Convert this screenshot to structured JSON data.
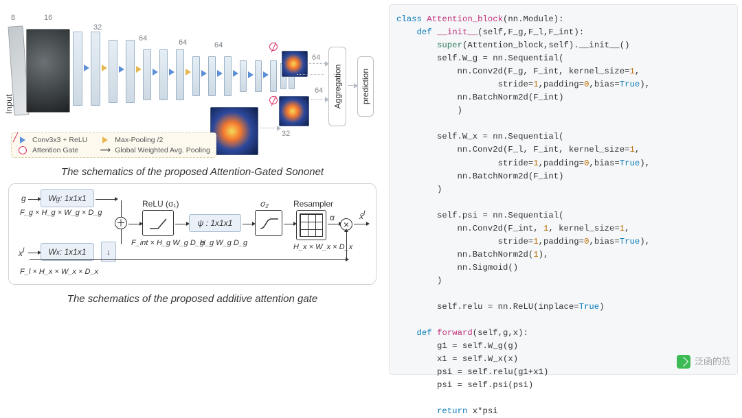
{
  "top": {
    "input_label": "Input",
    "channels": [
      "8",
      "16",
      "32",
      "64",
      "64",
      "64"
    ],
    "side_numbers": {
      "n64a": "64",
      "n64b": "64",
      "n32": "32"
    },
    "agg": "Aggregation",
    "pred": "prediction",
    "legend": {
      "conv": "Conv3x3 + ReLU",
      "maxpool": "Max-Pooling /2",
      "gate": "Attention Gate",
      "gwap": "Global Weighted Avg. Pooling"
    },
    "caption": "The schematics of the proposed Attention-Gated Sononet"
  },
  "gate": {
    "g": "g",
    "xl": "x",
    "xl_sup": "l",
    "Wg": "W",
    "Wg_sub": "g",
    "conv1": ": 1x1x1",
    "Wx": "W",
    "Wx_sub": "x",
    "Fg": "F_g × H_g × W_g × D_g",
    "Fl": "F_l × H_x × W_x × D_x",
    "Fint": "F_int × H_g W_g  D_g",
    "relu": "ReLU (σ₁)",
    "psi": "ψ : 1x1x1",
    "HgWgDg": "H_g W_g  D_g",
    "sigma2": "σ₂",
    "resampler": "Resampler",
    "HxWxDx": "H_x × W_x × D_x",
    "alpha": "α",
    "xhat": "x̂",
    "xhat_sup": "l",
    "caption": "The schematics of the proposed additive attention gate"
  },
  "code": {
    "l1": "class Attention_block(nn.Module):",
    "l2": "    def __init__(self,F_g,F_l,F_int):",
    "l3": "        super(Attention_block,self).__init__()",
    "l4": "        self.W_g = nn.Sequential(",
    "l5": "            nn.Conv2d(F_g, F_int, kernel_size=1,",
    "l6": "                    stride=1,padding=0,bias=True),",
    "l7": "            nn.BatchNorm2d(F_int)",
    "l8": "            )",
    "l9": "",
    "l10": "        self.W_x = nn.Sequential(",
    "l11": "            nn.Conv2d(F_l, F_int, kernel_size=1,",
    "l12": "                    stride=1,padding=0,bias=True),",
    "l13": "            nn.BatchNorm2d(F_int)",
    "l14": "        )",
    "l15": "",
    "l16": "        self.psi = nn.Sequential(",
    "l17": "            nn.Conv2d(F_int, 1, kernel_size=1,",
    "l18": "                    stride=1,padding=0,bias=True),",
    "l19": "            nn.BatchNorm2d(1),",
    "l20": "            nn.Sigmoid()",
    "l21": "        )",
    "l22": "",
    "l23": "        self.relu = nn.ReLU(inplace=True)",
    "l24": "",
    "l25": "    def forward(self,g,x):",
    "l26": "        g1 = self.W_g(g)",
    "l27": "        x1 = self.W_x(x)",
    "l28": "        psi = self.relu(g1+x1)",
    "l29": "        psi = self.psi(psi)",
    "l30": "",
    "l31": "        return x*psi"
  },
  "watermark": "泛函的范"
}
